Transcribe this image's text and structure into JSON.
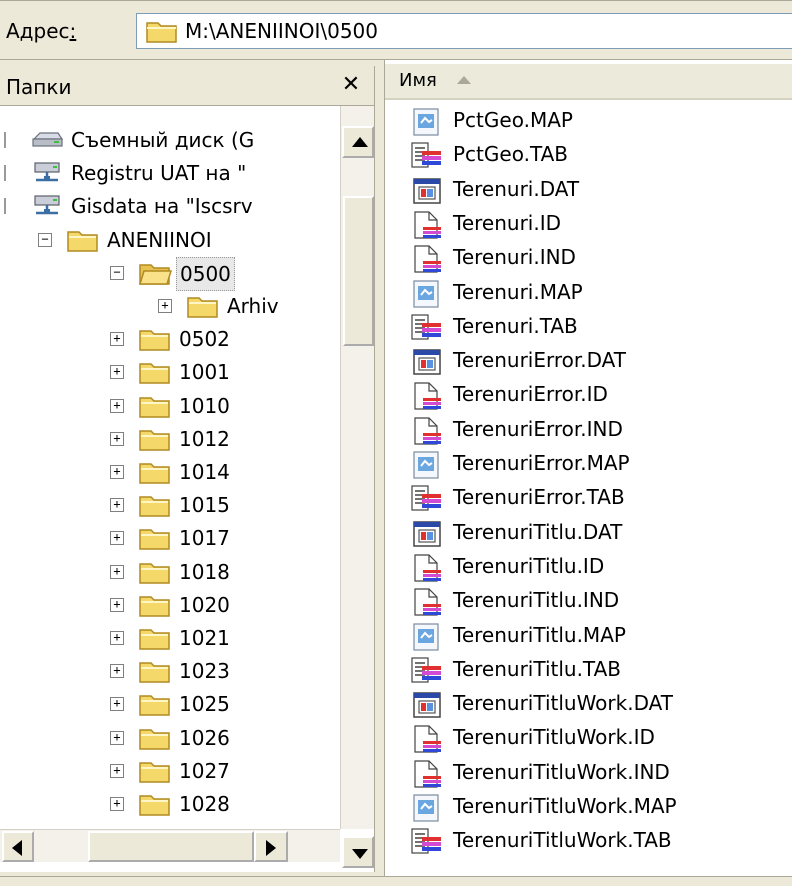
{
  "address": {
    "label": "Адрес",
    "accelerator": ":",
    "path": "M:\\ANENIINOI\\0500"
  },
  "folders_pane": {
    "title": "Папки",
    "close_glyph": "✕",
    "tree": [
      {
        "label": "Съемный диск (G",
        "icon": "removable-disk-icon",
        "level": 0,
        "toggle": "none"
      },
      {
        "label": "Registru UAT на \"",
        "icon": "network-drive-icon",
        "level": 0,
        "toggle": "none"
      },
      {
        "label": "Gisdata на \"Iscsrv",
        "icon": "network-drive-icon",
        "level": 0,
        "toggle": "none"
      },
      {
        "label": "ANENIINOI",
        "icon": "folder-icon",
        "level": 1,
        "toggle": "minus"
      },
      {
        "label": "0500",
        "icon": "open-folder-icon",
        "level": 2,
        "toggle": "minus",
        "selected": true
      },
      {
        "label": "Arhiv",
        "icon": "folder-icon",
        "level": 3,
        "toggle": "plus"
      },
      {
        "label": "0502",
        "icon": "folder-icon",
        "level": 2,
        "toggle": "plus"
      },
      {
        "label": "1001",
        "icon": "folder-icon",
        "level": 2,
        "toggle": "plus"
      },
      {
        "label": "1010",
        "icon": "folder-icon",
        "level": 2,
        "toggle": "plus"
      },
      {
        "label": "1012",
        "icon": "folder-icon",
        "level": 2,
        "toggle": "plus"
      },
      {
        "label": "1014",
        "icon": "folder-icon",
        "level": 2,
        "toggle": "plus"
      },
      {
        "label": "1015",
        "icon": "folder-icon",
        "level": 2,
        "toggle": "plus"
      },
      {
        "label": "1017",
        "icon": "folder-icon",
        "level": 2,
        "toggle": "plus"
      },
      {
        "label": "1018",
        "icon": "folder-icon",
        "level": 2,
        "toggle": "plus"
      },
      {
        "label": "1020",
        "icon": "folder-icon",
        "level": 2,
        "toggle": "plus"
      },
      {
        "label": "1021",
        "icon": "folder-icon",
        "level": 2,
        "toggle": "plus"
      },
      {
        "label": "1023",
        "icon": "folder-icon",
        "level": 2,
        "toggle": "plus"
      },
      {
        "label": "1025",
        "icon": "folder-icon",
        "level": 2,
        "toggle": "plus"
      },
      {
        "label": "1026",
        "icon": "folder-icon",
        "level": 2,
        "toggle": "plus"
      },
      {
        "label": "1027",
        "icon": "folder-icon",
        "level": 2,
        "toggle": "plus"
      },
      {
        "label": "1028",
        "icon": "folder-icon",
        "level": 2,
        "toggle": "plus"
      }
    ]
  },
  "files_pane": {
    "column_name": "Имя",
    "files": [
      {
        "name": "PctGeo.MAP",
        "type": "map"
      },
      {
        "name": "PctGeo.TAB",
        "type": "tab"
      },
      {
        "name": "Terenuri.DAT",
        "type": "dat"
      },
      {
        "name": "Terenuri.ID",
        "type": "id"
      },
      {
        "name": "Terenuri.IND",
        "type": "id"
      },
      {
        "name": "Terenuri.MAP",
        "type": "map"
      },
      {
        "name": "Terenuri.TAB",
        "type": "tab"
      },
      {
        "name": "TerenuriError.DAT",
        "type": "dat"
      },
      {
        "name": "TerenuriError.ID",
        "type": "id"
      },
      {
        "name": "TerenuriError.IND",
        "type": "id"
      },
      {
        "name": "TerenuriError.MAP",
        "type": "map"
      },
      {
        "name": "TerenuriError.TAB",
        "type": "tab"
      },
      {
        "name": "TerenuriTitlu.DAT",
        "type": "dat"
      },
      {
        "name": "TerenuriTitlu.ID",
        "type": "id"
      },
      {
        "name": "TerenuriTitlu.IND",
        "type": "id"
      },
      {
        "name": "TerenuriTitlu.MAP",
        "type": "map"
      },
      {
        "name": "TerenuriTitlu.TAB",
        "type": "tab"
      },
      {
        "name": "TerenuriTitluWork.DAT",
        "type": "dat"
      },
      {
        "name": "TerenuriTitluWork.ID",
        "type": "id"
      },
      {
        "name": "TerenuriTitluWork.IND",
        "type": "id"
      },
      {
        "name": "TerenuriTitluWork.MAP",
        "type": "map"
      },
      {
        "name": "TerenuriTitluWork.TAB",
        "type": "tab"
      }
    ]
  },
  "colors": {
    "folder_yellow": "#f5d86a",
    "chrome": "#ece9d8",
    "selection_bg": "#e8e8e8"
  }
}
